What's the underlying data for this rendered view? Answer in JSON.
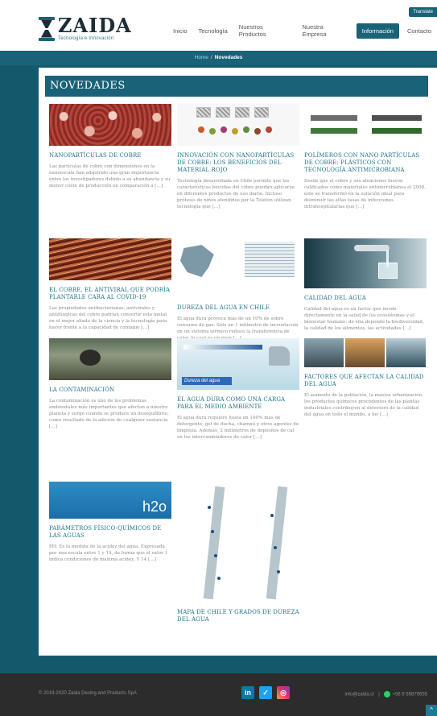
{
  "header": {
    "brand_name": "ZAIDA",
    "brand_tagline": "Tecnología e Innovación",
    "translate_label": "Translate",
    "nav": [
      {
        "label": "Inicio"
      },
      {
        "label": "Tecnología"
      },
      {
        "label": "Nuestros Productos"
      },
      {
        "label": "Nuestra Empresa"
      },
      {
        "label": "Información",
        "active": true
      },
      {
        "label": "Contacto"
      }
    ]
  },
  "breadcrumb": {
    "home": "Home",
    "separator": "/",
    "current": "Novedades"
  },
  "section_title": "NOVEDADES",
  "articles": [
    {
      "title": "NANOPARTÍCULAS DE COBRE",
      "text": "Las partículas de cobre con dimensiones en la nanoescala han adquirido una gran importancia entre los investigadores debido a su abundancia y su menor coste de producción en comparación a […]"
    },
    {
      "title": "INNOVACIÓN CON NANOPARTÍCULAS DE COBRE: LOS BENEFICIOS DEL MATERIAL ROJO",
      "text": "Tecnología desarrollada en Chile permite que las características biocidas del cobre puedan aplicarse en diferentes productos de uso diario. Incluso prótesis de niños atendidos por la Teletón utilizan tecnología que […]"
    },
    {
      "title": "POLÍMEROS CON NANO PARTÍCULAS DE COBRE: PLÁSTICOS CON TECNOLOGÍA ANTIMICROBIANA",
      "text": "Desde que el cobre y sus aleaciones fueron calificados como materiales antimicrobianos el 2008, este se transformó en la solución ideal para disminuir las altas tasas de infecciones intrahospitalarias que […]"
    },
    {
      "title": "EL COBRE, EL ANTIVIRAL QUE PODRÍA PLANTARLE CARA AL COVID-19",
      "text": "Las propiedades antibacterianas, antivirales y antifúngicas del cobre podrían convertir este metal en el mejor aliado de la ciencia y la tecnología para hacer frente a la capacidad de contagio […]"
    },
    {
      "title": "DUREZA DEL AGUA EN CHILE",
      "text": "El agua dura provoca más de un 10% de sobre consumo de gas. Sólo un 1 milímetro de incrustación en un sistema térmico reduce la transferencia de calor, lo cual es un gran […]"
    },
    {
      "title": "CALIDAD DEL AGUA",
      "text": "Calidad del agua es un factor que incide directamente en la salud de los ecosistemas y el bienestar humano: de ella depende la biodiversidad, la calidad de los alimentos, las actividades […]"
    },
    {
      "title": "LA CONTAMINACIÓN",
      "text": "La contaminación es uno de los problemas ambientales más importantes que afectan a nuestro planeta y surge cuando se produce un desequilibrio, como resultado de la adición de cualquier sustancia […]"
    },
    {
      "title": "EL AGUA DURA COMO UNA CARGA PARA EL MEDIO AMBIENTE",
      "text": "El agua dura requiere hasta un 100% más de detergente, gel de ducha, champú y otros agentes de limpieza. Además, 2 milímetros de depósitos de cal en los intercambiadores de calor […]",
      "image_caption": "Dureza del agua",
      "scale_labels": [
        "0",
        "75",
        "150",
        "300 +"
      ]
    },
    {
      "title": "FACTORES QUE AFECTAN LA CALIDAD DEL AGUA",
      "text": "El aumento de la población, la masiva urbanización, los productos químicos procedentes de las plantas industriales contribuyen al deterioro de la calidad del agua en todo el mundo, a los […]"
    },
    {
      "title": "PARÁMETROS FÍSICO-QUÍMICOS DE LAS AGUAS",
      "text": "PH: Es la medida de la acidez del agua. Expresada por una escala entre 1 y 14, de forma que el valor 1 indica condiciones de máxima acidez, Y 14 […]",
      "image_caption": "h2o"
    },
    {
      "title": "MAPA DE CHILE Y GRADOS DE DUREZA DEL AGUA",
      "text": ""
    }
  ],
  "footer": {
    "copyright": "© 2019-2020 Zaida Desing and Products SpA",
    "email": "info@zaida.cl",
    "divider": "|",
    "phone": "+56 9 56879655",
    "social": [
      "in",
      "t",
      "ig"
    ],
    "back_to_top": "^"
  },
  "colors": {
    "primary": "#1a6277",
    "link": "#1f7389",
    "footer": "#2c2c2c"
  }
}
